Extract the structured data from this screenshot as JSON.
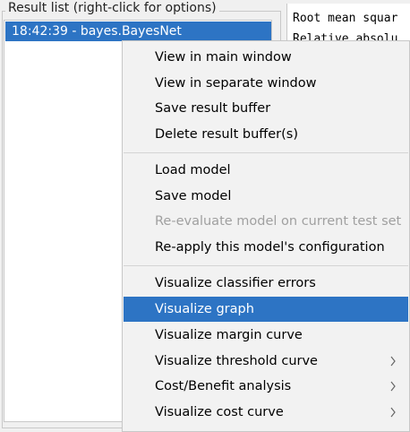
{
  "result_list": {
    "legend": "Result list (right-click for options)",
    "selected_item": "18:42:39 - bayes.BayesNet"
  },
  "output": {
    "lines": [
      "Root mean squar",
      "Relative absolu"
    ]
  },
  "context_menu": {
    "groups": [
      [
        {
          "label": "View in main window",
          "enabled": true
        },
        {
          "label": "View in separate window",
          "enabled": true
        },
        {
          "label": "Save result buffer",
          "enabled": true
        },
        {
          "label": "Delete result buffer(s)",
          "enabled": true
        }
      ],
      [
        {
          "label": "Load model",
          "enabled": true
        },
        {
          "label": "Save model",
          "enabled": true
        },
        {
          "label": "Re-evaluate model on current test set",
          "enabled": false
        },
        {
          "label": "Re-apply this model's configuration",
          "enabled": true
        }
      ],
      [
        {
          "label": "Visualize classifier errors",
          "enabled": true
        },
        {
          "label": "Visualize graph",
          "enabled": true,
          "highlighted": true
        },
        {
          "label": "Visualize margin curve",
          "enabled": true
        },
        {
          "label": "Visualize threshold curve",
          "enabled": true,
          "submenu": true
        },
        {
          "label": "Cost/Benefit analysis",
          "enabled": true,
          "submenu": true
        },
        {
          "label": "Visualize cost curve",
          "enabled": true,
          "submenu": true
        }
      ]
    ]
  },
  "colors": {
    "selection": "#2d74c4",
    "disabled_text": "#a0a0a0"
  }
}
